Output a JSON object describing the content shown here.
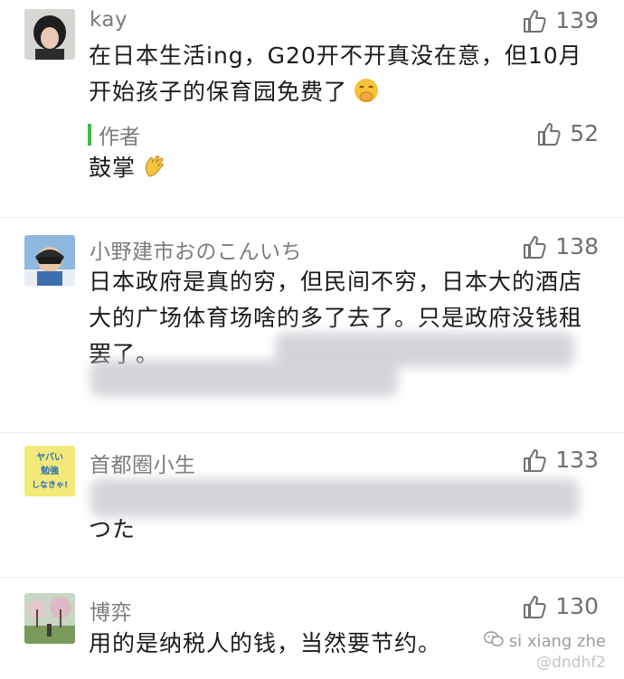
{
  "comments": [
    {
      "username": "kay",
      "likes": "139",
      "text": "在日本生活ing，G20开不开真没在意，但10月开始孩子的保育园免费了",
      "reply": {
        "author_label": "作者",
        "likes": "52",
        "text": "鼓掌"
      }
    },
    {
      "username": "小野建市おのこんいち",
      "likes": "138",
      "text": "日本政府是真的穷，但民间不穷，日本大的酒店大的广场体育场啥的多了去了。只是政府没钱租罢了。"
    },
    {
      "username": "首都圈小生",
      "likes": "133",
      "text": "つた"
    },
    {
      "username": "博弈",
      "likes": "130",
      "text": "用的是纳税人的钱，当然要节约。"
    }
  ],
  "watermark": {
    "line1": "si xiang zhe",
    "line2": "@dndhf2"
  },
  "colors": {
    "author_bar": "#3fba4a",
    "meta_text": "#7b7b7b",
    "body_text": "#1a1a1a"
  },
  "icons": [
    "thumbs-up-icon",
    "clapping-hands-emoji",
    "hand-over-mouth-emoji",
    "wechat-icon"
  ]
}
